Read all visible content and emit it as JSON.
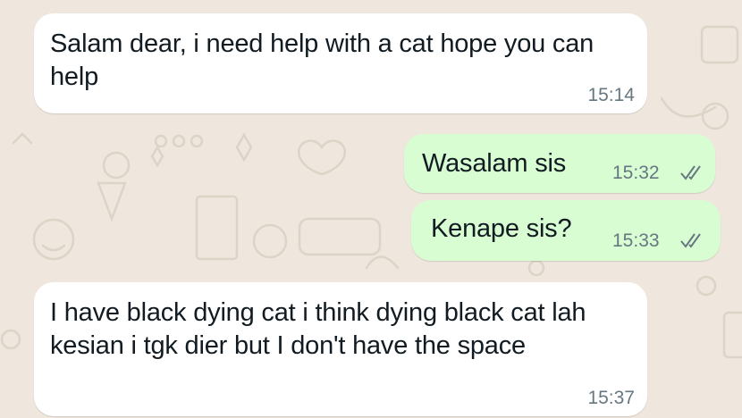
{
  "colors": {
    "wallpaper": "#efe7dd",
    "incoming_bubble": "#ffffff",
    "outgoing_bubble": "#d9fdd3",
    "text": "#111b21",
    "meta": "#667781"
  },
  "messages": [
    {
      "direction": "incoming",
      "text": "Salam dear, i need help with a cat hope you can help",
      "time": "15:14"
    },
    {
      "direction": "outgoing",
      "text": "Wasalam sis",
      "time": "15:32",
      "status_icon": "double-check-icon"
    },
    {
      "direction": "outgoing",
      "text": "Kenape sis?",
      "time": "15:33",
      "status_icon": "double-check-icon"
    },
    {
      "direction": "incoming",
      "text": "I have black dying cat i think dying black cat lah kesian i tgk dier but I don't have the space",
      "time": "15:37"
    }
  ]
}
